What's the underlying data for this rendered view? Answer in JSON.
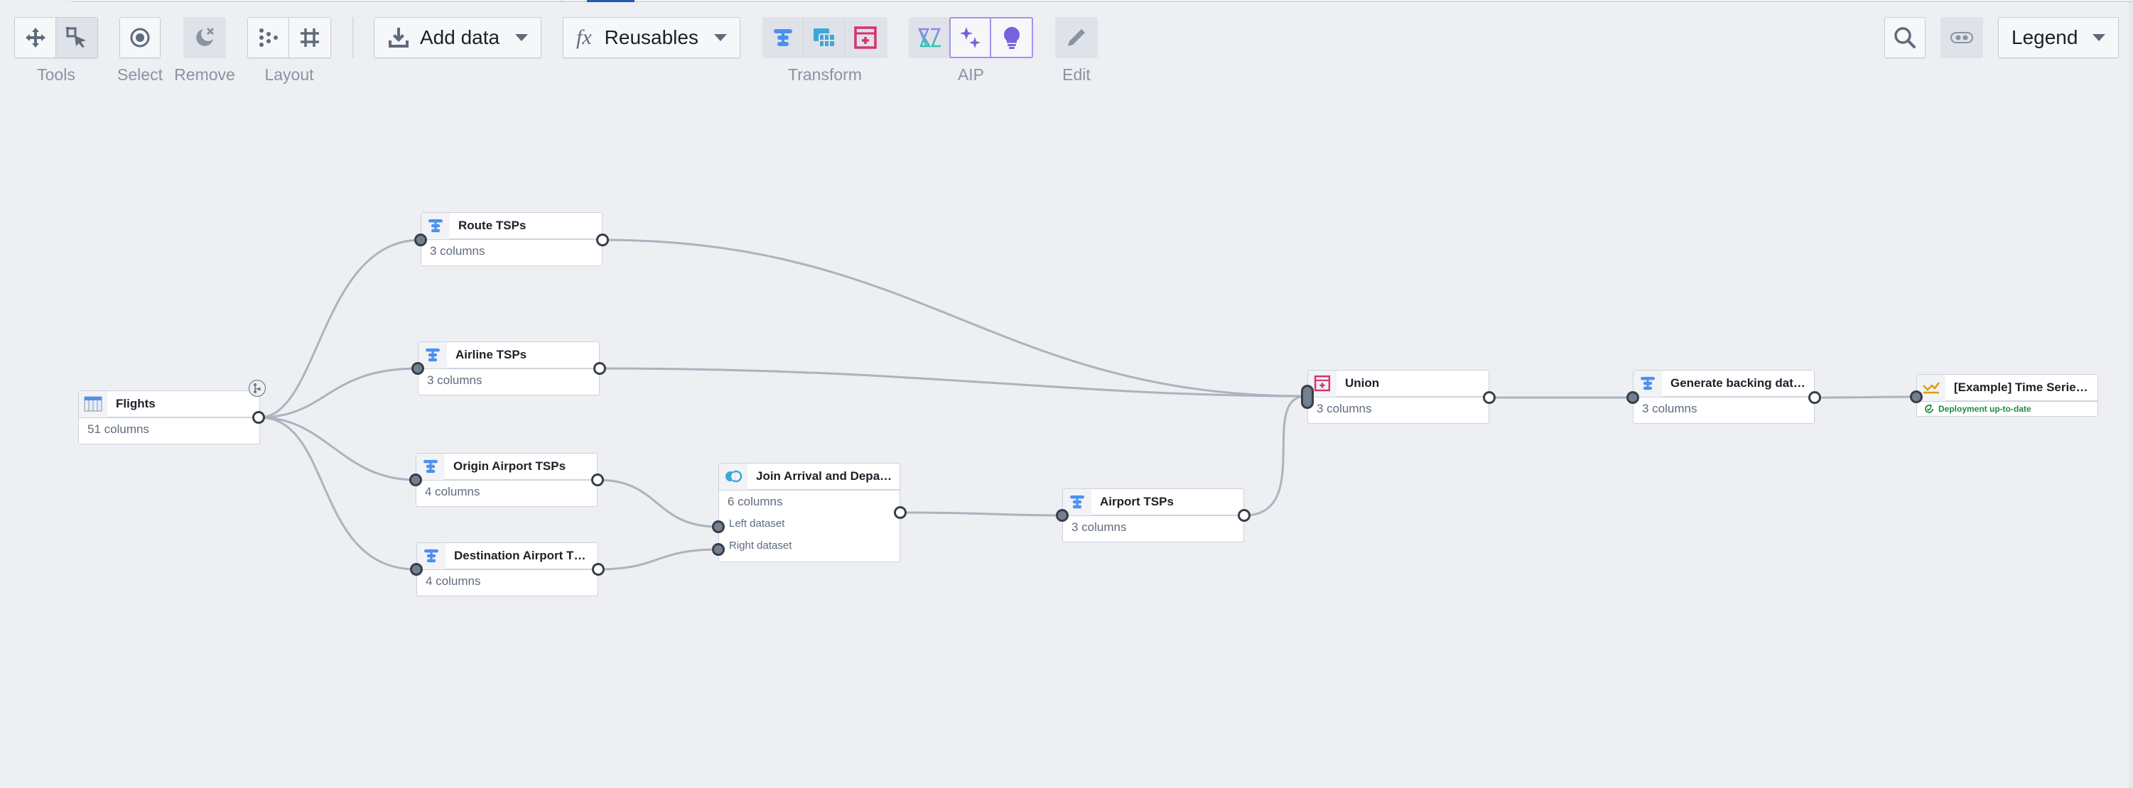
{
  "toolbar": {
    "groups": {
      "tools": "Tools",
      "select": "Select",
      "remove": "Remove",
      "layout": "Layout",
      "transform": "Transform",
      "aip": "AIP",
      "edit": "Edit"
    },
    "add_data": "Add data",
    "reusables": "Reusables",
    "reusables_icon": "fx",
    "legend": "Legend",
    "colors": {
      "transform_blue": "#4c90f0",
      "pivot_blue": "#3fa6da",
      "union_pink": "#d6336c",
      "aip_purple": "#7961db"
    }
  },
  "graph": {
    "nodes": [
      {
        "id": "flights",
        "title": "Flights",
        "subtitle": "51 columns",
        "icon": "dataset-table-icon"
      },
      {
        "id": "route",
        "title": "Route TSPs",
        "subtitle": "3 columns",
        "icon": "transform-icon"
      },
      {
        "id": "airline",
        "title": "Airline TSPs",
        "subtitle": "3 columns",
        "icon": "transform-icon"
      },
      {
        "id": "origin",
        "title": "Origin Airport TSPs",
        "subtitle": "4 columns",
        "icon": "transform-icon"
      },
      {
        "id": "destination",
        "title": "Destination Airport TSPs",
        "subtitle": "4 columns",
        "icon": "transform-icon"
      },
      {
        "id": "join",
        "title": "Join Arrival and Departu…",
        "subtitle": "6 columns",
        "icon": "join-icon",
        "ports": [
          "Left dataset",
          "Right dataset"
        ]
      },
      {
        "id": "airport",
        "title": "Airport TSPs",
        "subtitle": "3 columns",
        "icon": "transform-icon"
      },
      {
        "id": "union",
        "title": "Union",
        "subtitle": "3 columns",
        "icon": "union-icon"
      },
      {
        "id": "generate",
        "title": "Generate backing datase…",
        "subtitle": "3 columns",
        "icon": "transform-icon"
      },
      {
        "id": "timeseries",
        "title": "[Example] Time Series S…",
        "status": "Deployment up-to-date",
        "icon": "line-chart-icon"
      }
    ],
    "edges": [
      [
        "flights",
        "route"
      ],
      [
        "flights",
        "airline"
      ],
      [
        "flights",
        "origin"
      ],
      [
        "flights",
        "destination"
      ],
      [
        "origin",
        "join.left"
      ],
      [
        "destination",
        "join.right"
      ],
      [
        "join",
        "airport"
      ],
      [
        "route",
        "union"
      ],
      [
        "airline",
        "union"
      ],
      [
        "airport",
        "union"
      ],
      [
        "union",
        "generate"
      ],
      [
        "generate",
        "timeseries"
      ]
    ]
  }
}
